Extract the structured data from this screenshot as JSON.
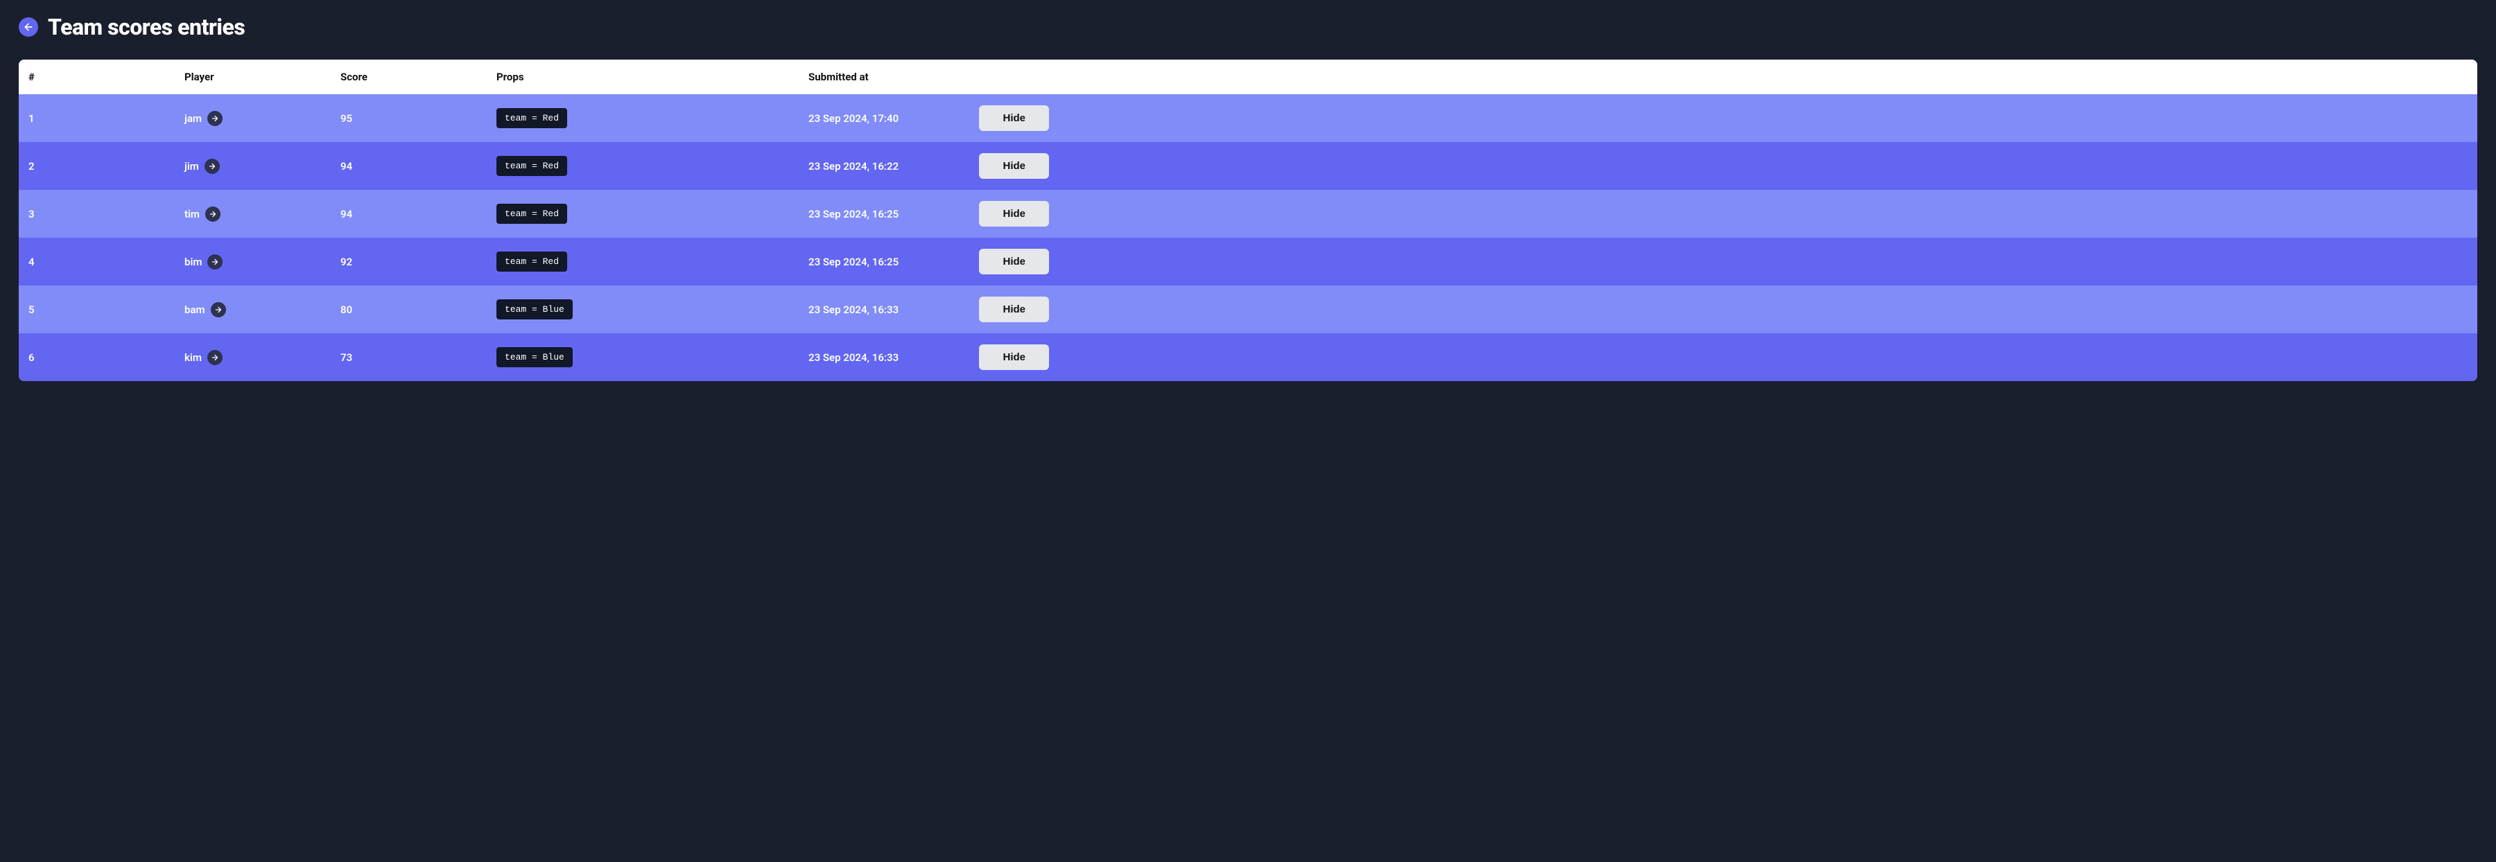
{
  "page": {
    "title": "Team scores entries"
  },
  "table": {
    "headers": {
      "rank": "#",
      "player": "Player",
      "score": "Score",
      "props": "Props",
      "submitted": "Submitted at"
    },
    "rows": [
      {
        "rank": "1",
        "player": "jam",
        "score": "95",
        "props": "team = Red",
        "submitted": "23 Sep 2024, 17:40",
        "action": "Hide"
      },
      {
        "rank": "2",
        "player": "jim",
        "score": "94",
        "props": "team = Red",
        "submitted": "23 Sep 2024, 16:22",
        "action": "Hide"
      },
      {
        "rank": "3",
        "player": "tim",
        "score": "94",
        "props": "team = Red",
        "submitted": "23 Sep 2024, 16:25",
        "action": "Hide"
      },
      {
        "rank": "4",
        "player": "bim",
        "score": "92",
        "props": "team = Red",
        "submitted": "23 Sep 2024, 16:25",
        "action": "Hide"
      },
      {
        "rank": "5",
        "player": "bam",
        "score": "80",
        "props": "team = Blue",
        "submitted": "23 Sep 2024, 16:33",
        "action": "Hide"
      },
      {
        "rank": "6",
        "player": "kim",
        "score": "73",
        "props": "team = Blue",
        "submitted": "23 Sep 2024, 16:33",
        "action": "Hide"
      }
    ]
  }
}
